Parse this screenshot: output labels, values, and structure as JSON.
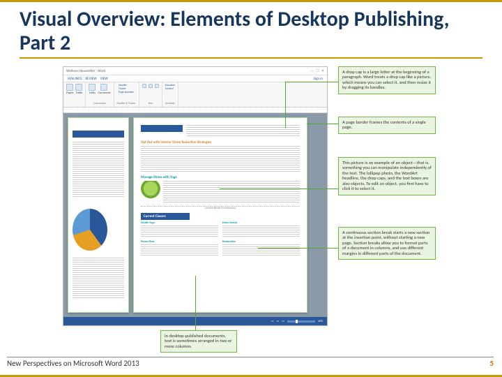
{
  "title": "Visual Overview: Elements of Desktop Publishing, Part 2",
  "footer": {
    "left": "New Perspectives on Microsoft Word 2013",
    "page": "5"
  },
  "word_window": {
    "title": "Wellness Newsletter - Word",
    "signin": "Sign in",
    "tabs": {
      "mailings": "MAILINGS",
      "review": "REVIEW",
      "view": "VIEW"
    },
    "ribbon": {
      "pages": "Pages",
      "table": "Table",
      "links": "Links",
      "comment": "Comment",
      "header": "Header",
      "footer_item": "Footer",
      "page_number": "Page Number",
      "text": "Text",
      "equation": "Equation",
      "symbol": "Symbol",
      "group_comments": "Comments",
      "group_hf": "Header & Footer",
      "group_symbols": "Symbols"
    },
    "doc": {
      "heading1": "Opt Out with Interior Stress Reduction Strategies",
      "heading2": "Manage Stress with Yoga",
      "section_break": "Section Break (Continuous)",
      "classes_title": "Current Classes",
      "class_a": "Gentle Yoga",
      "class_b": "Power Flow",
      "class_c": "Deep Stretch",
      "class_d": "Restorative"
    },
    "status": {
      "zoom": "50%"
    }
  },
  "callouts": {
    "c1": "A drop cap is a large letter at the beginning of a paragraph. Word treats a drop cap like a picture, which means you can select it, and then resize it by dragging its handles.",
    "c2": "A page border frames the contents of a single page.",
    "c3": "This picture is an example of an object—that is, something you can manipulate independently of the text. The lollipop photo, the WordArt headline, the drop caps, and the text boxes are also objects. To edit an object, you first have to click it to select it.",
    "c4": "A continuous section break starts a new section at the insertion point, without starting a new page. Section breaks allow you to format parts of a document in columns, and use different margins in different parts of the document.",
    "c5": "In desktop-published documents, text is sometimes arranged in two or more columns."
  }
}
